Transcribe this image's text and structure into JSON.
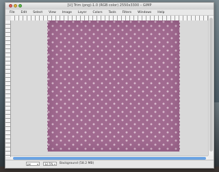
{
  "window": {
    "title": "[U] Trim (png)-1.0 (RGB color) 2550x3300 – GIMP"
  },
  "menubar": {
    "items": [
      "File",
      "Edit",
      "Select",
      "View",
      "Image",
      "Layer",
      "Colors",
      "Tools",
      "Filters",
      "Windows",
      "Help"
    ]
  },
  "canvas": {
    "pattern_base_color": "#a16a90",
    "pattern_dot_color": "#d7b8cc"
  },
  "statusbar": {
    "unit": "px",
    "zoom": "12.5%",
    "status_text": "Background (58.2 MB)"
  }
}
